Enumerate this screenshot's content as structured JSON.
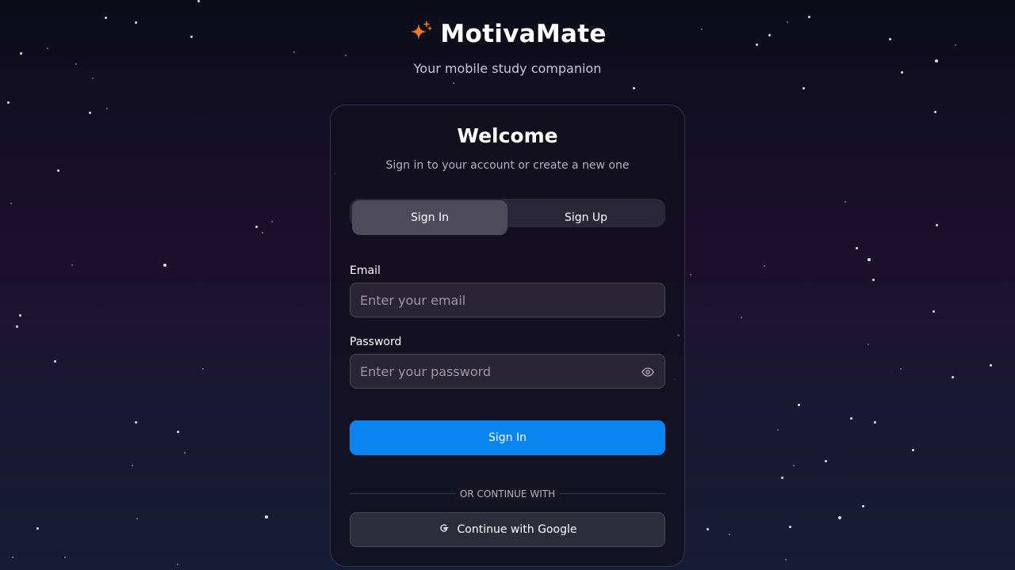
{
  "app": {
    "name": "MotivaMate",
    "tagline": "Your mobile study companion",
    "logo_icon": "sparkles-icon",
    "accent_color": "#f47a20"
  },
  "card": {
    "title": "Welcome",
    "subtitle": "Sign in to your account or create a new one"
  },
  "tabs": [
    {
      "label": "Sign In",
      "active": true
    },
    {
      "label": "Sign Up",
      "active": false
    }
  ],
  "form": {
    "email_label": "Email",
    "email_placeholder": "Enter your email",
    "email_value": "",
    "password_label": "Password",
    "password_placeholder": "Enter your password",
    "password_value": "",
    "password_toggle_icon": "eye-icon",
    "submit_label": "Sign In",
    "submit_color": "#0a84f0"
  },
  "divider": {
    "text": "OR CONTINUE WITH"
  },
  "google": {
    "label": "Continue with Google",
    "icon": "google-icon"
  }
}
